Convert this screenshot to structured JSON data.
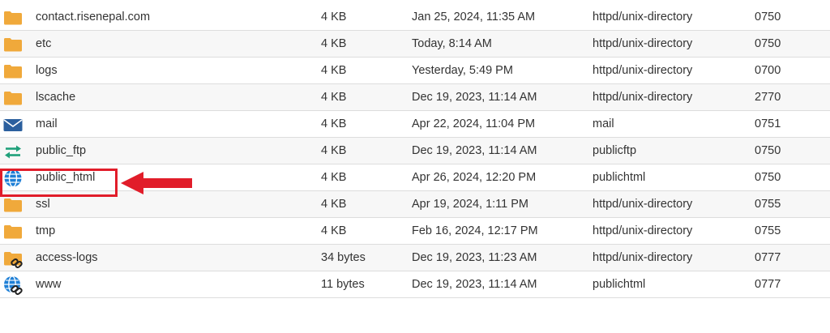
{
  "files": [
    {
      "icon": "folder-icon",
      "name": "contact.risenepal.com",
      "size": "4 KB",
      "date": "Jan 25, 2024, 11:35 AM",
      "type": "httpd/unix-directory",
      "perms": "0750"
    },
    {
      "icon": "folder-icon",
      "name": "etc",
      "size": "4 KB",
      "date": "Today, 8:14 AM",
      "type": "httpd/unix-directory",
      "perms": "0750"
    },
    {
      "icon": "folder-icon",
      "name": "logs",
      "size": "4 KB",
      "date": "Yesterday, 5:49 PM",
      "type": "httpd/unix-directory",
      "perms": "0700"
    },
    {
      "icon": "folder-icon",
      "name": "lscache",
      "size": "4 KB",
      "date": "Dec 19, 2023, 11:14 AM",
      "type": "httpd/unix-directory",
      "perms": "2770"
    },
    {
      "icon": "mail-envelope-icon",
      "name": "mail",
      "size": "4 KB",
      "date": "Apr 22, 2024, 11:04 PM",
      "type": "mail",
      "perms": "0751"
    },
    {
      "icon": "transfer-arrows-icon",
      "name": "public_ftp",
      "size": "4 KB",
      "date": "Dec 19, 2023, 11:14 AM",
      "type": "publicftp",
      "perms": "0750"
    },
    {
      "icon": "globe-icon",
      "name": "public_html",
      "size": "4 KB",
      "date": "Apr 26, 2024, 12:20 PM",
      "type": "publichtml",
      "perms": "0750"
    },
    {
      "icon": "folder-icon",
      "name": "ssl",
      "size": "4 KB",
      "date": "Apr 19, 2024, 1:11 PM",
      "type": "httpd/unix-directory",
      "perms": "0755"
    },
    {
      "icon": "folder-icon",
      "name": "tmp",
      "size": "4 KB",
      "date": "Feb 16, 2024, 12:17 PM",
      "type": "httpd/unix-directory",
      "perms": "0755"
    },
    {
      "icon": "folder-link-icon",
      "name": "access-logs",
      "size": "34 bytes",
      "date": "Dec 19, 2023, 11:23 AM",
      "type": "httpd/unix-directory",
      "perms": "0777"
    },
    {
      "icon": "globe-link-icon",
      "name": "www",
      "size": "11 bytes",
      "date": "Dec 19, 2023, 11:14 AM",
      "type": "publichtml",
      "perms": "0777"
    }
  ],
  "colors": {
    "folder": "#f0a93b",
    "mail": "#2b5f9e",
    "ftp": "#1fa07a",
    "globe": "#1e7fd6",
    "highlight": "#e11d2a",
    "row_alt": "#f7f7f7"
  }
}
